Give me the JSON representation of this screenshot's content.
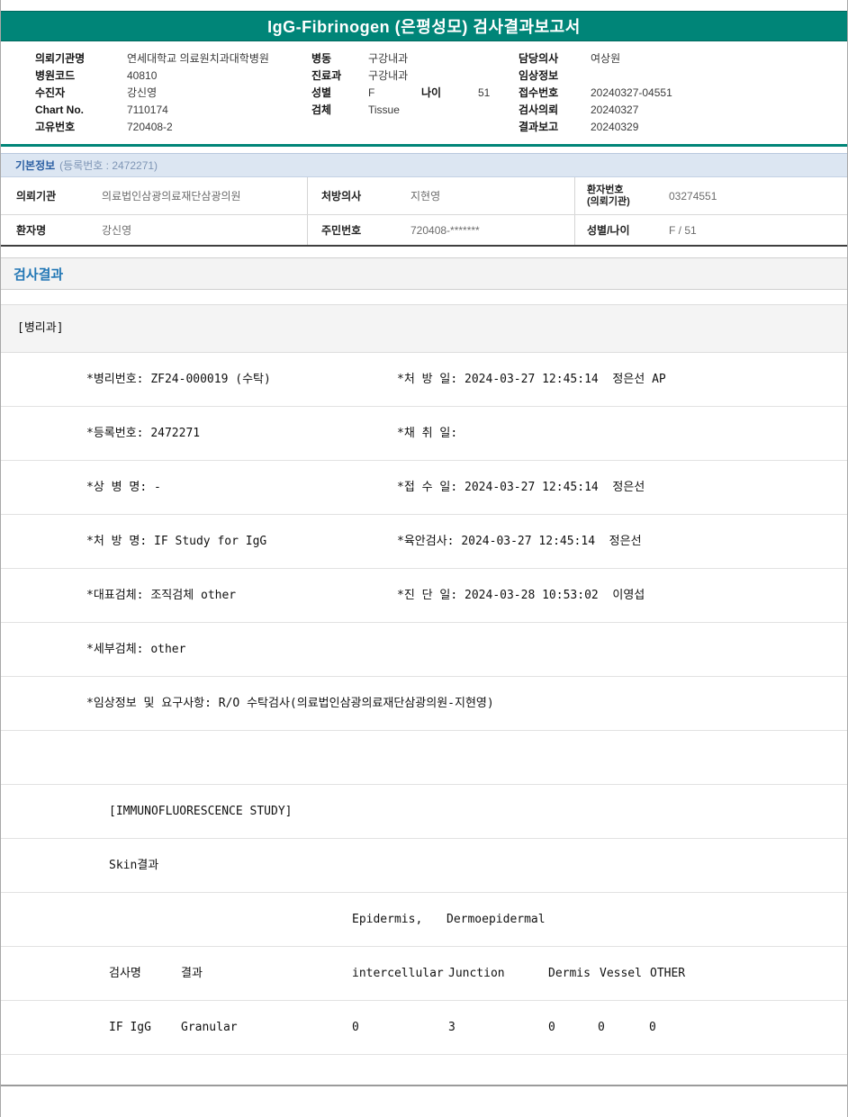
{
  "header": {
    "title": "IgG-Fibrinogen (은평성모) 검사결과보고서"
  },
  "patient_info": {
    "col1": [
      {
        "label": "의뢰기관명",
        "value": "연세대학교 의료원치과대학병원"
      },
      {
        "label": "병원코드",
        "value": "40810"
      },
      {
        "label": "수진자",
        "value": "강신영"
      },
      {
        "label": "Chart No.",
        "value": "7110174"
      },
      {
        "label": "고유번호",
        "value": "720408-2"
      }
    ],
    "col2": [
      {
        "label": "병동",
        "value": "구강내과"
      },
      {
        "label": "진료과",
        "value": "구강내과"
      },
      {
        "label": "성별",
        "value": "F"
      },
      {
        "label": "검체",
        "value": "Tissue"
      }
    ],
    "age": {
      "label": "나이",
      "value": "51"
    },
    "col3": [
      {
        "label": "담당의사",
        "value": "여상원"
      },
      {
        "label": "임상정보",
        "value": ""
      },
      {
        "label": "접수번호",
        "value": "20240327-04551"
      },
      {
        "label": "검사의뢰",
        "value": "20240327"
      },
      {
        "label": "결과보고",
        "value": "20240329"
      }
    ]
  },
  "basic_info": {
    "title": "기본정보",
    "reg_no": "(등록번호 : 2472271)",
    "row1": {
      "label1": "의뢰기관",
      "value1": "의료법인삼광의료재단삼광의원",
      "label2": "처방의사",
      "value2": "지현영",
      "label3": "환자번호\n(의뢰기관)",
      "value3": "03274551"
    },
    "row2": {
      "label1": "환자명",
      "value1": "강신영",
      "label2": "주민번호",
      "value2": "720408-*******",
      "label3": "성별/나이",
      "value3": "F / 51"
    }
  },
  "results": {
    "title": "검사결과",
    "department": "[병리과]",
    "rows": [
      {
        "left": "*병리번호: ZF24-000019 (수탁)",
        "right": "*처 방 일: 2024-03-27 12:45:14  정은선 AP"
      },
      {
        "left": "*등록번호: 2472271",
        "right": "*채 취 일:"
      },
      {
        "left": "*상 병 명: -",
        "right": "*접 수 일: 2024-03-27 12:45:14  정은선"
      },
      {
        "left": "*처 방 명: IF Study for IgG",
        "right": "*육안검사: 2024-03-27 12:45:14  정은선"
      },
      {
        "left": "*대표검체: 조직검체 other",
        "right": "*진 단 일: 2024-03-28 10:53:02  이영섭"
      },
      {
        "left": "*세부검체: other",
        "right": ""
      },
      {
        "left": "*임상정보 및 요구사항: R/O 수탁검사(의료법인삼광의료재단삼광의원-지현영)",
        "right": ""
      },
      {
        "left": "",
        "right": ""
      }
    ],
    "if_study": {
      "section_title": "[IMMUNOFLUORESCENCE STUDY]",
      "subtitle": "Skin결과",
      "group_header": {
        "col1": "Epidermis,",
        "col2": "Dermoepidermal"
      },
      "columns": {
        "test": "검사명",
        "result": "결과",
        "intercellular": "intercellular",
        "junction": "Junction",
        "dermis": "Dermis",
        "vessel": "Vessel",
        "other": "OTHER"
      },
      "data_row": {
        "test": "IF IgG",
        "result": "Granular",
        "intercellular": "0",
        "junction": "3",
        "dermis": "0",
        "vessel": "0",
        "other": "0"
      }
    }
  },
  "colors": {
    "banner_teal": "#008578",
    "basic_bar_bg": "#dce6f2",
    "basic_title_blue": "#2b5fa3",
    "results_title_blue": "#2277b5"
  }
}
